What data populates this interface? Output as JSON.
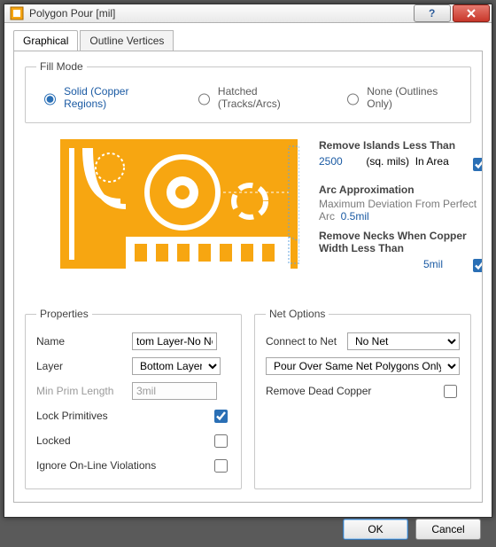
{
  "window": {
    "title": "Polygon Pour [mil]"
  },
  "tabs": {
    "graphical": "Graphical",
    "outline": "Outline Vertices"
  },
  "fill": {
    "legend": "Fill Mode",
    "solid": "Solid (Copper Regions)",
    "hatched": "Hatched (Tracks/Arcs)",
    "none": "None (Outlines Only)"
  },
  "opts": {
    "islands_hdr": "Remove Islands Less Than",
    "islands_val": "2500",
    "islands_unit": "(sq. mils)",
    "islands_tail": "In Area",
    "islands_checked": true,
    "arc_hdr": "Arc Approximation",
    "arc_desc": "Maximum Deviation From Perfect Arc",
    "arc_val": "0.5mil",
    "necks_hdr": "Remove Necks When Copper Width Less Than",
    "necks_val": "5mil",
    "necks_checked": true
  },
  "props": {
    "legend": "Properties",
    "name_lbl": "Name",
    "name_val": "tom Layer-No Net",
    "layer_lbl": "Layer",
    "layer_val": "Bottom Layer",
    "minprim_lbl": "Min Prim Length",
    "minprim_val": "3mil",
    "lockprim_lbl": "Lock Primitives",
    "lockprim_checked": true,
    "locked_lbl": "Locked",
    "locked_checked": false,
    "ignore_lbl": "Ignore On-Line Violations",
    "ignore_checked": false
  },
  "net": {
    "legend": "Net Options",
    "connect_lbl": "Connect to Net",
    "connect_val": "No Net",
    "pour_val": "Pour Over Same Net Polygons Only",
    "remove_lbl": "Remove Dead Copper",
    "remove_checked": false
  },
  "buttons": {
    "ok": "OK",
    "cancel": "Cancel"
  }
}
